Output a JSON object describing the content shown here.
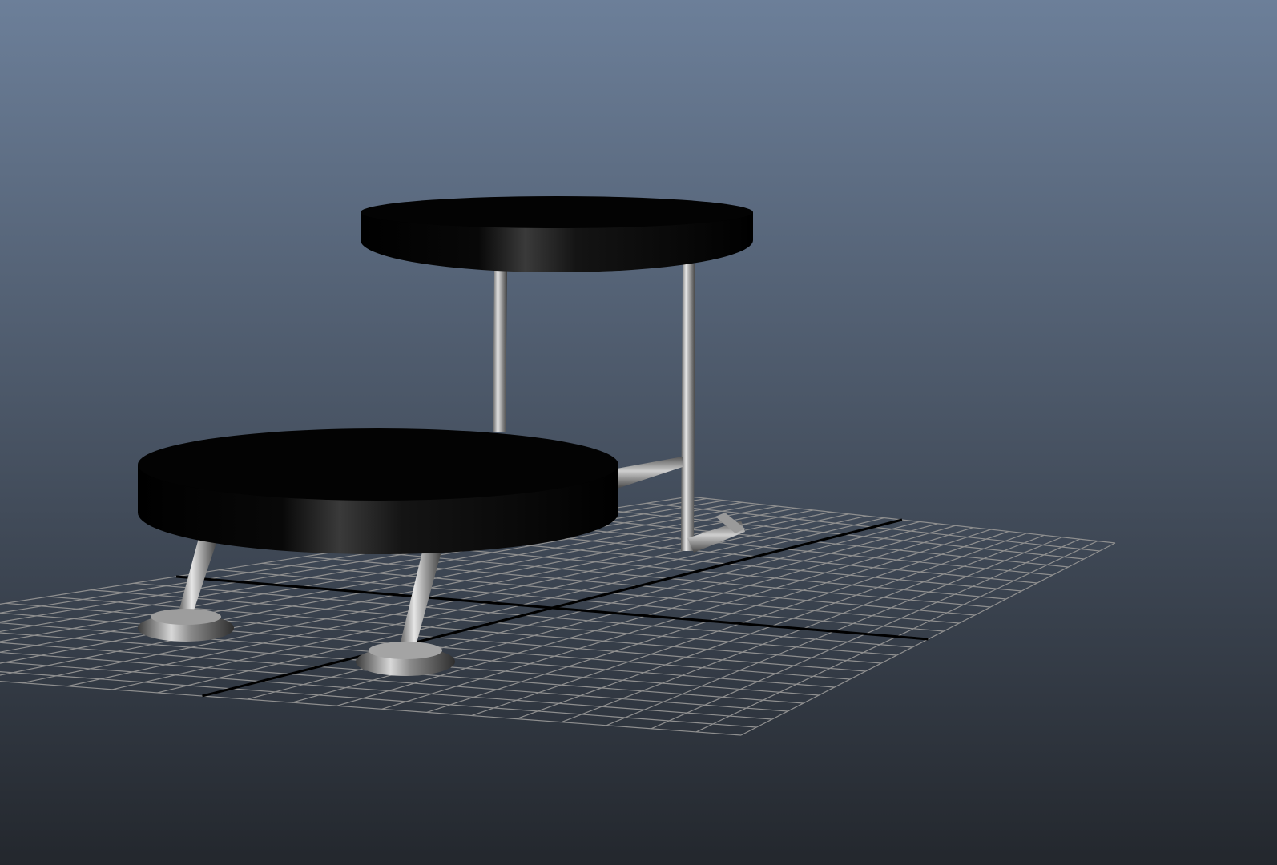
{
  "viewport": {
    "panel": "perspective-viewport",
    "background_top_color": "#6c7f99",
    "background_bottom_color": "#23272d",
    "grid_line_color": "#8f8f8f",
    "grid_axis_color": "#000000",
    "seat_color": "#050505",
    "leg_color": "#b8b8b8"
  },
  "scene": {
    "objects": [
      {
        "name": "stool-back-seat",
        "type": "cylinder"
      },
      {
        "name": "stool-front-seat",
        "type": "cylinder"
      },
      {
        "name": "stool-back-frame",
        "type": "metal-frame"
      },
      {
        "name": "stool-front-legs",
        "type": "metal-legs"
      },
      {
        "name": "ground-grid",
        "type": "grid"
      }
    ]
  }
}
